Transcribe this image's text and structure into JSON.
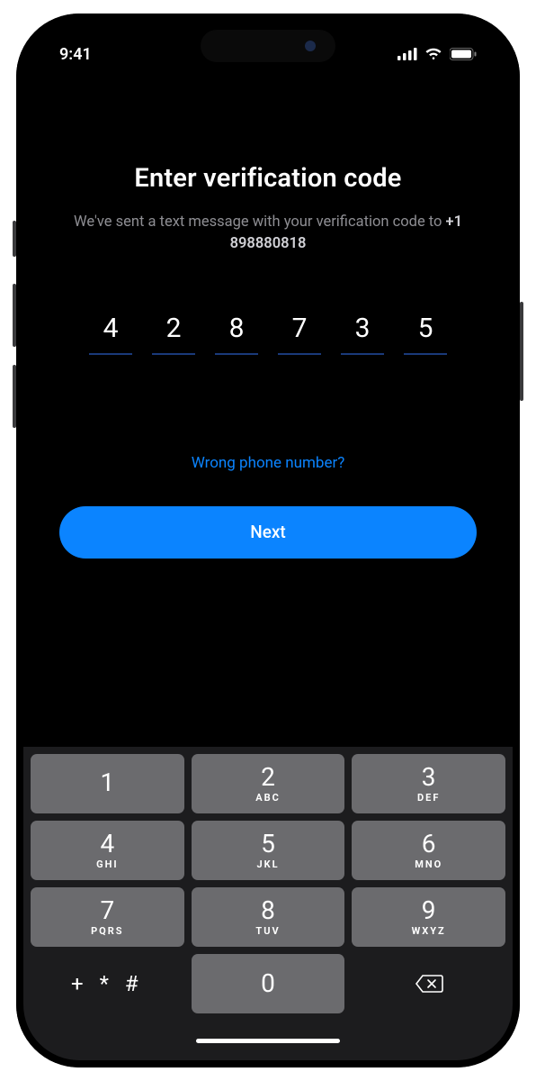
{
  "status": {
    "time": "9:41"
  },
  "screen": {
    "title": "Enter verification code",
    "subtitle_prefix": "We've sent a text message with your verification code to ",
    "phone_number": "+1 898880818",
    "code_digits": [
      "4",
      "2",
      "8",
      "7",
      "3",
      "5"
    ],
    "wrong_link": "Wrong phone number?",
    "next_label": "Next"
  },
  "keypad": {
    "keys": [
      {
        "num": "1",
        "let": ""
      },
      {
        "num": "2",
        "let": "ABC"
      },
      {
        "num": "3",
        "let": "DEF"
      },
      {
        "num": "4",
        "let": "GHI"
      },
      {
        "num": "5",
        "let": "JKL"
      },
      {
        "num": "6",
        "let": "MNO"
      },
      {
        "num": "7",
        "let": "PQRS"
      },
      {
        "num": "8",
        "let": "TUV"
      },
      {
        "num": "9",
        "let": "WXYZ"
      }
    ],
    "symbols": "+ * #",
    "zero": "0"
  },
  "colors": {
    "accent": "#0b84ff"
  }
}
